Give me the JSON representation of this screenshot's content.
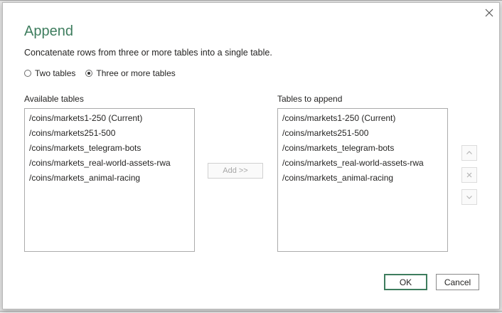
{
  "dialog": {
    "title": "Append",
    "description": "Concatenate rows from three or more tables into a single table.",
    "close_icon": "close-icon"
  },
  "mode": {
    "options": [
      {
        "label": "Two tables",
        "checked": false
      },
      {
        "label": "Three or more tables",
        "checked": true
      }
    ]
  },
  "available": {
    "label": "Available tables",
    "items": [
      "/coins/markets1-250 (Current)",
      "/coins/markets251-500",
      "/coins/markets_telegram-bots",
      "/coins/markets_real-world-assets-rwa",
      "/coins/markets_animal-racing"
    ]
  },
  "append": {
    "label": "Tables to append",
    "items": [
      "/coins/markets1-250 (Current)",
      "/coins/markets251-500",
      "/coins/markets_telegram-bots",
      "/coins/markets_real-world-assets-rwa",
      "/coins/markets_animal-racing"
    ]
  },
  "buttons": {
    "add_label": "Add >>",
    "ok_label": "OK",
    "cancel_label": "Cancel",
    "move_up_icon": "chevron-up-icon",
    "remove_icon": "remove-icon",
    "move_down_icon": "chevron-down-icon"
  },
  "colors": {
    "accent": "#3e7d5e",
    "disabled": "#a6a6a6"
  }
}
